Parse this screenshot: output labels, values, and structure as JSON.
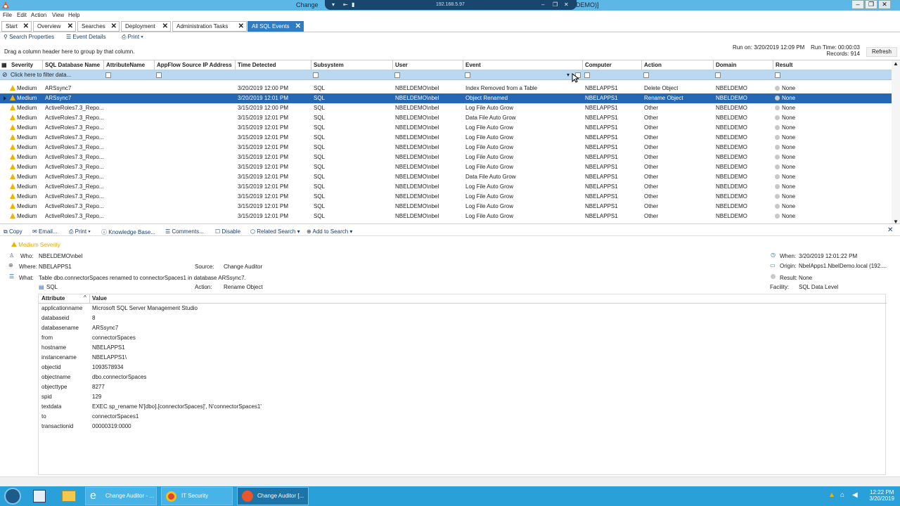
{
  "window": {
    "title": "Change",
    "title_suffix": "DEMO)]",
    "rdp_ip": "192.168.5.97"
  },
  "menu": [
    "File",
    "Edit",
    "Action",
    "View",
    "Help"
  ],
  "tabs": [
    {
      "label": "Start"
    },
    {
      "label": "Overview"
    },
    {
      "label": "Searches"
    },
    {
      "label": "Deployment"
    },
    {
      "label": "Administration Tasks"
    },
    {
      "label": "All SQL Events",
      "active": true
    }
  ],
  "toolbar": {
    "search_props": "Search Properties",
    "event_details": "Event Details",
    "print": "Print"
  },
  "grid": {
    "group_hint": "Drag a column header here to group by that column.",
    "run_on_label": "Run on:",
    "run_on": "3/20/2019 12:09 PM",
    "run_time_label": "Run Time:",
    "run_time": "00:00:03",
    "records_label": "Records:",
    "records": "914",
    "refresh": "Refresh",
    "filter_text": "Click here to filter data...",
    "columns": [
      "Severity",
      "SQL Database Name",
      "AttributeName",
      "AppFlow Source IP Address",
      "Time Detected",
      "Subsystem",
      "User",
      "Event",
      "Computer",
      "Action",
      "Domain",
      "Result"
    ],
    "rows": [
      [
        "Medium",
        "ARSsync7",
        "",
        "",
        "3/20/2019 12:00 PM",
        "SQL",
        "NBELDEMO\\nbel",
        "Index Removed from a Table",
        "NBELAPPS1",
        "Delete Object",
        "NBELDEMO",
        "None"
      ],
      [
        "Medium",
        "ARSsync7",
        "",
        "",
        "3/20/2019 12:01 PM",
        "SQL",
        "NBELDEMO\\nbel",
        "Object Renamed",
        "NBELAPPS1",
        "Rename Object",
        "NBELDEMO",
        "None"
      ],
      [
        "Medium",
        "ActiveRoles7.3_Repo...",
        "",
        "",
        "3/15/2019 12:00 PM",
        "SQL",
        "NBELDEMO\\nbel",
        "Log File Auto Grow",
        "NBELAPPS1",
        "Other",
        "NBELDEMO",
        "None"
      ],
      [
        "Medium",
        "ActiveRoles7.3_Repo...",
        "",
        "",
        "3/15/2019 12:01 PM",
        "SQL",
        "NBELDEMO\\nbel",
        "Data File Auto Grow",
        "NBELAPPS1",
        "Other",
        "NBELDEMO",
        "None"
      ],
      [
        "Medium",
        "ActiveRoles7.3_Repo...",
        "",
        "",
        "3/15/2019 12:01 PM",
        "SQL",
        "NBELDEMO\\nbel",
        "Log File Auto Grow",
        "NBELAPPS1",
        "Other",
        "NBELDEMO",
        "None"
      ],
      [
        "Medium",
        "ActiveRoles7.3_Repo...",
        "",
        "",
        "3/15/2019 12:01 PM",
        "SQL",
        "NBELDEMO\\nbel",
        "Log File Auto Grow",
        "NBELAPPS1",
        "Other",
        "NBELDEMO",
        "None"
      ],
      [
        "Medium",
        "ActiveRoles7.3_Repo...",
        "",
        "",
        "3/15/2019 12:01 PM",
        "SQL",
        "NBELDEMO\\nbel",
        "Log File Auto Grow",
        "NBELAPPS1",
        "Other",
        "NBELDEMO",
        "None"
      ],
      [
        "Medium",
        "ActiveRoles7.3_Repo...",
        "",
        "",
        "3/15/2019 12:01 PM",
        "SQL",
        "NBELDEMO\\nbel",
        "Log File Auto Grow",
        "NBELAPPS1",
        "Other",
        "NBELDEMO",
        "None"
      ],
      [
        "Medium",
        "ActiveRoles7.3_Repo...",
        "",
        "",
        "3/15/2019 12:01 PM",
        "SQL",
        "NBELDEMO\\nbel",
        "Log File Auto Grow",
        "NBELAPPS1",
        "Other",
        "NBELDEMO",
        "None"
      ],
      [
        "Medium",
        "ActiveRoles7.3_Repo...",
        "",
        "",
        "3/15/2019 12:01 PM",
        "SQL",
        "NBELDEMO\\nbel",
        "Data File Auto Grow",
        "NBELAPPS1",
        "Other",
        "NBELDEMO",
        "None"
      ],
      [
        "Medium",
        "ActiveRoles7.3_Repo...",
        "",
        "",
        "3/15/2019 12:01 PM",
        "SQL",
        "NBELDEMO\\nbel",
        "Log File Auto Grow",
        "NBELAPPS1",
        "Other",
        "NBELDEMO",
        "None"
      ],
      [
        "Medium",
        "ActiveRoles7.3_Repo...",
        "",
        "",
        "3/15/2019 12:01 PM",
        "SQL",
        "NBELDEMO\\nbel",
        "Log File Auto Grow",
        "NBELAPPS1",
        "Other",
        "NBELDEMO",
        "None"
      ],
      [
        "Medium",
        "ActiveRoles7.3_Repo...",
        "",
        "",
        "3/15/2019 12:01 PM",
        "SQL",
        "NBELDEMO\\nbel",
        "Log File Auto Grow",
        "NBELAPPS1",
        "Other",
        "NBELDEMO",
        "None"
      ],
      [
        "Medium",
        "ActiveRoles7.3_Repo...",
        "",
        "",
        "3/15/2019 12:01 PM",
        "SQL",
        "NBELDEMO\\nbel",
        "Log File Auto Grow",
        "NBELAPPS1",
        "Other",
        "NBELDEMO",
        "None"
      ]
    ],
    "selected_row": 1
  },
  "detail_toolbar": {
    "copy": "Copy",
    "email": "Email...",
    "print": "Print",
    "kb": "Knowledge Base...",
    "comments": "Comments...",
    "disable": "Disable",
    "related": "Related Search",
    "add": "Add to Search"
  },
  "detail": {
    "severity": "Medium Severity",
    "who_label": "Who:",
    "who": "NBELDEMO\\nbel",
    "where_label": "Where:",
    "where": "NBELAPPS1",
    "source_label": "Source:",
    "source": "Change Auditor",
    "what_label": "What:",
    "what": "Table dbo.connectorSpaces renamed to connectorSpaces1 in database ARSsync7.",
    "subsystem": "SQL",
    "action_label": "Action:",
    "action": "Rename Object",
    "when_label": "When:",
    "when": "3/20/2019 12:01:22 PM",
    "origin_label": "Origin:",
    "origin": "NbelApps1.NbelDemo.local (192....",
    "result_label": "Result:",
    "result": "None",
    "facility_label": "Facility:",
    "facility": "SQL Data Level",
    "attr_header": "Attribute",
    "value_header": "Value",
    "attributes": [
      [
        "applicationname",
        "Microsoft SQL Server Management Studio"
      ],
      [
        "databaseid",
        "8"
      ],
      [
        "databasename",
        "ARSsync7"
      ],
      [
        "from",
        "connectorSpaces"
      ],
      [
        "hostname",
        "NBELAPPS1"
      ],
      [
        "instancename",
        "NBELAPPS1\\"
      ],
      [
        "objectid",
        "1093578934"
      ],
      [
        "objectname",
        "dbo.connectorSpaces"
      ],
      [
        "objecttype",
        "8277"
      ],
      [
        "spid",
        "129"
      ],
      [
        "textdata",
        "EXEC sp_rename N'[dbo].[connectorSpaces]', N'connectorSpaces1'"
      ],
      [
        "to",
        "connectorSpaces1"
      ],
      [
        "transactionid",
        "00000319:0000"
      ]
    ]
  },
  "taskbar": {
    "items": [
      {
        "label": "Change Auditor - ..."
      },
      {
        "label": "IT Security Search..."
      },
      {
        "label": "Change Auditor [..."
      }
    ],
    "time": "12:22 PM",
    "date": "3/20/2019"
  },
  "colors": {
    "accent": "#2467b4",
    "filter": "#b9d9f3",
    "taskbar": "#2aa0d8",
    "warn": "#f0b400"
  }
}
